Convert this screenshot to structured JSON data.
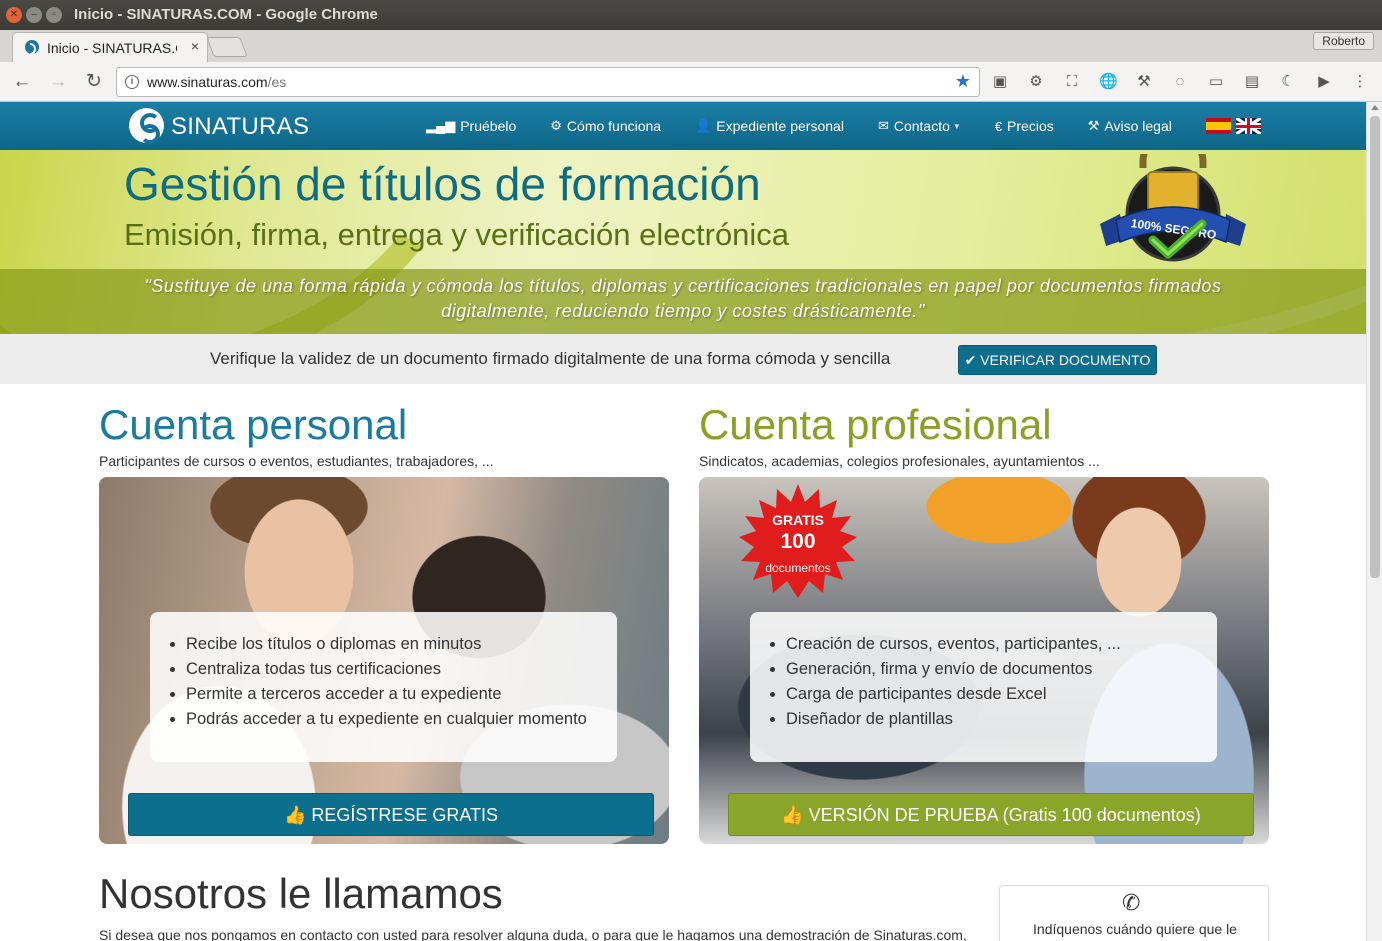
{
  "window": {
    "title": "Inicio - SINATURAS.COM - Google Chrome",
    "profile": "Roberto"
  },
  "tabs": [
    {
      "title": "Inicio - SINATURAS.COM",
      "close": "×"
    }
  ],
  "omnibox": {
    "url_host": "www.sinaturas.com",
    "url_path": "/es"
  },
  "site": {
    "logo_text": "SINATURAS",
    "nav": [
      {
        "label": "Pruébelo",
        "icon": "signal-icon",
        "glyph": "▂▄▆"
      },
      {
        "label": "Cómo funciona",
        "icon": "gear-icon",
        "glyph": "⚙"
      },
      {
        "label": "Expediente personal",
        "icon": "user-icon",
        "glyph": "👤"
      },
      {
        "label": "Contacto",
        "icon": "envelope-icon",
        "glyph": "✉"
      },
      {
        "label": "Precios",
        "icon": "euro-icon",
        "glyph": "€"
      },
      {
        "label": "Aviso legal",
        "icon": "gavel-icon",
        "glyph": "⚒"
      }
    ],
    "languages": [
      "es",
      "en"
    ],
    "hero": {
      "title": "Gestión de títulos de formación",
      "subtitle": "Emisión, firma, entrega y verificación electrónica",
      "quote_line1": "\"Sustituye de una forma rápida y cómoda los títulos, diplomas y certificaciones tradicionales en papel por documentos firmados",
      "quote_line2": "digitalmente, reduciendo tiempo y costes drásticamente.\"",
      "badge_text": "100% SEGURO"
    },
    "verify": {
      "text": "Verifique la validez de un documento firmado digitalmente de una forma cómoda y sencilla",
      "button": "VERIFICAR DOCUMENTO"
    },
    "personal": {
      "title": "Cuenta personal",
      "subtitle": "Participantes de cursos o eventos, estudiantes, trabajadores, ...",
      "bullets": [
        "Recibe los títulos o diplomas en minutos",
        "Centraliza todas tus certificaciones",
        "Permite a terceros acceder a tu expediente",
        "Podrás acceder a tu expediente en cualquier momento"
      ],
      "cta": "REGÍSTRESE GRATIS"
    },
    "professional": {
      "title": "Cuenta profesional",
      "subtitle": "Sindicatos, academias, colegios profesionales, ayuntamientos ...",
      "burst_line1": "GRATIS",
      "burst_line2": "100",
      "burst_line3": "documentos",
      "bullets": [
        "Creación de cursos, eventos, participantes, ...",
        "Generación, firma y envío de documentos",
        "Carga de participantes desde Excel",
        "Diseñador de plantillas"
      ],
      "cta": "VERSIÓN DE PRUEBA (Gratis 100 documentos)"
    },
    "callus": {
      "title": "Nosotros le llamamos",
      "text": "Si desea que nos pongamos en contacto con usted para resolver alguna duda, o para que le hagamos una demostración de Sinaturas.com,",
      "box_text": "Indíquenos cuándo quiere que le"
    }
  },
  "colors": {
    "nav": "#0e6e8e",
    "accent_green": "#8ba52b",
    "title_blue": "#0f6c80"
  }
}
